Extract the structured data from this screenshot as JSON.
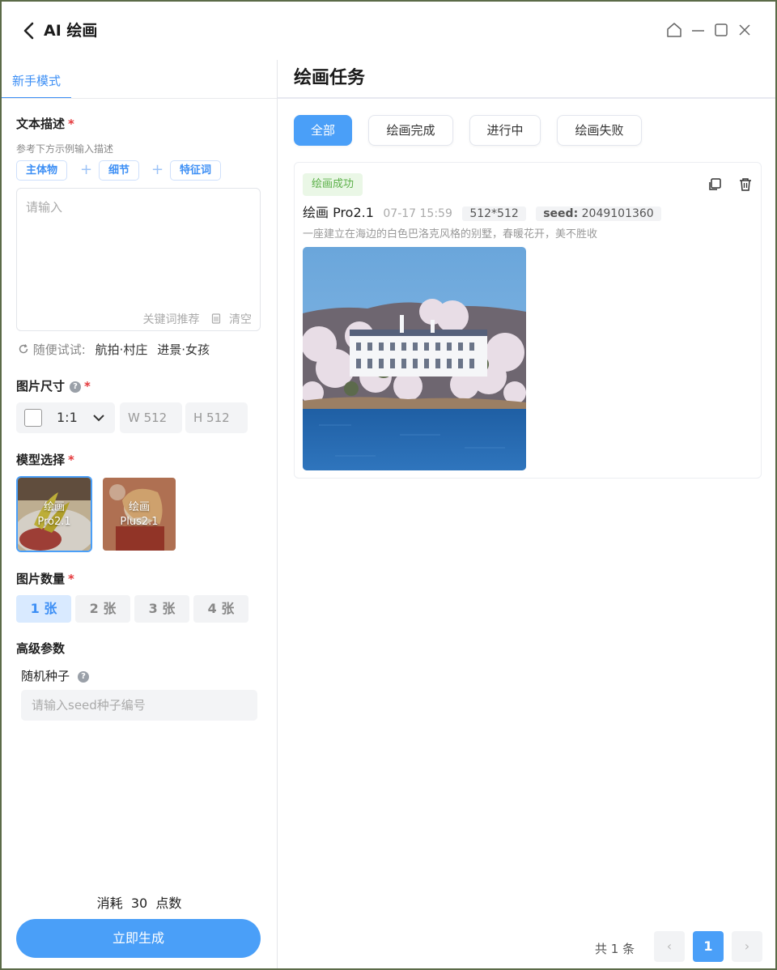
{
  "window": {
    "title": "AI 绘画"
  },
  "left": {
    "mode_tab": "新手模式",
    "text_desc": {
      "label": "文本描述",
      "hint": "参考下方示例输入描述",
      "chips": [
        "主体物",
        "细节",
        "特征词"
      ],
      "placeholder": "请输入",
      "keyword_recommend": "关键词推荐",
      "clear": "清空"
    },
    "random": {
      "label": "随便试试:",
      "options": [
        "航拍·村庄",
        "进景·女孩"
      ]
    },
    "image_size": {
      "label": "图片尺寸",
      "ratio": "1:1",
      "width": "W 512",
      "height": "H 512"
    },
    "model_select": {
      "label": "模型选择",
      "models": [
        {
          "line1": "绘画",
          "line2": "Pro2.1"
        },
        {
          "line1": "绘画",
          "line2": "Plus2.1"
        }
      ]
    },
    "image_count": {
      "label": "图片数量",
      "options": [
        "1 张",
        "2 张",
        "3 张",
        "4 张"
      ],
      "selected_index": 0
    },
    "advanced": {
      "label": "高级参数",
      "seed_label": "随机种子",
      "seed_placeholder": "请输入seed种子编号"
    },
    "cost": {
      "text": "消耗  30  点数"
    },
    "generate_button": "立即生成"
  },
  "right": {
    "title": "绘画任务",
    "filters": [
      "全部",
      "绘画完成",
      "进行中",
      "绘画失败"
    ],
    "active_filter_index": 0,
    "task": {
      "status": "绘画成功",
      "model": "绘画 Pro2.1",
      "time": "07-17 15:59",
      "size": "512*512",
      "seed_label": "seed:",
      "seed_value": "2049101360",
      "prompt": "一座建立在海边的白色巴洛克风格的别墅，春暖花开，美不胜收"
    },
    "pagination": {
      "total": "共 1 条",
      "prev": "‹",
      "current": "1",
      "next": "›"
    }
  },
  "colors": {
    "accent": "#4a9ff8",
    "success_bg": "#eaf7e6",
    "success_text": "#5bb048",
    "required": "#e4393c"
  },
  "icons": [
    "back-arrow-icon",
    "home-icon",
    "minimize-icon",
    "maximize-icon",
    "close-icon",
    "refresh-icon",
    "help-icon",
    "chevron-down-icon",
    "copy-icon",
    "trash-icon",
    "clear-icon"
  ]
}
